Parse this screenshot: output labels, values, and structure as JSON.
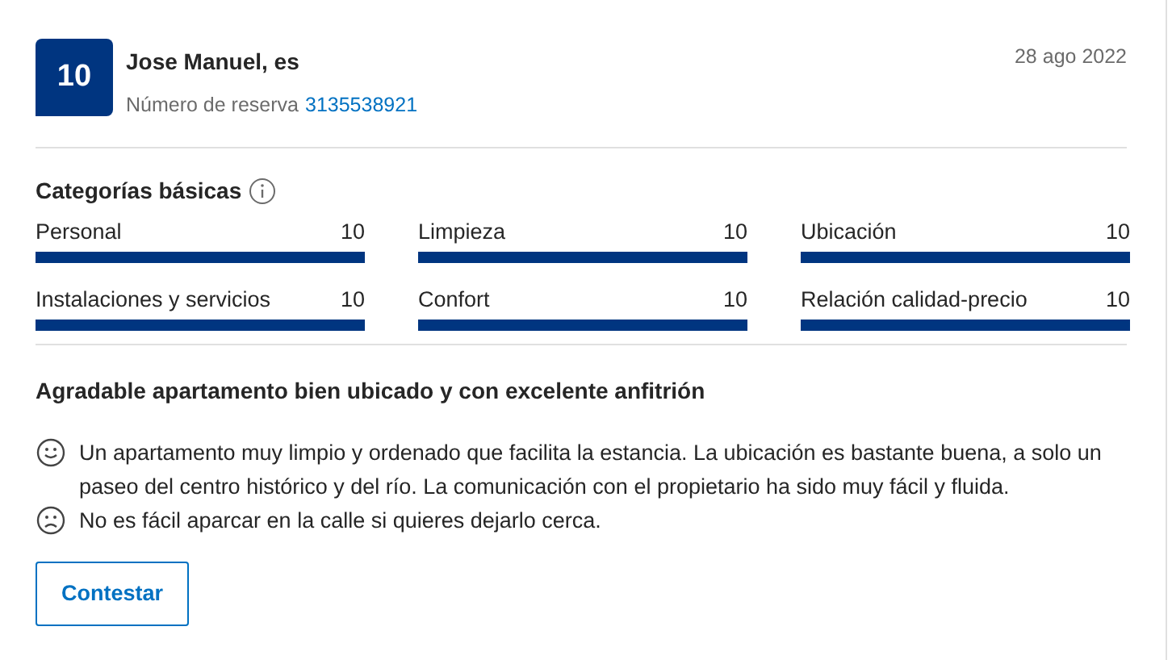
{
  "review": {
    "score": "10",
    "reviewer": "Jose Manuel, es",
    "booking_label": "Número de reserva",
    "booking_number": "3135538921",
    "date": "28 ago 2022"
  },
  "categories": {
    "title": "Categorías básicas",
    "items": [
      {
        "name": "Personal",
        "score": "10",
        "level": 1
      },
      {
        "name": "Limpieza",
        "score": "10",
        "level": 1
      },
      {
        "name": "Ubicación",
        "score": "10",
        "level": 1
      },
      {
        "name": "Instalaciones y servicios",
        "score": "10",
        "level": 1
      },
      {
        "name": "Confort",
        "score": "10",
        "level": 1
      },
      {
        "name": "Relación calidad-precio",
        "score": "10",
        "level": 1
      }
    ]
  },
  "headline": "Agradable apartamento bien ubicado y con excelente anfitrión",
  "comments": [
    {
      "kind": "positive",
      "text": "Un apartamento muy limpio y ordenado que facilita la estancia. La ubicación es bastante buena, a solo un paseo del centro histórico y del río. La comunicación con el propietario ha sido muy fácil y fluida."
    },
    {
      "kind": "negative",
      "text": "No es fácil aparcar en la calle si quieres dejarlo cerca."
    }
  ],
  "reply_button": "Contestar"
}
